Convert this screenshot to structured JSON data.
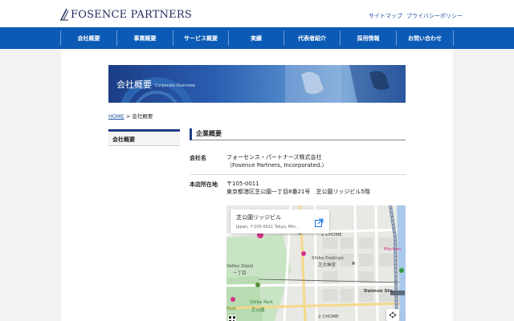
{
  "header": {
    "logo_text": "FOSENCE PARTNERS",
    "sitemap": "サイトマップ",
    "privacy": "プライバシーポリシー"
  },
  "nav": {
    "items": [
      "会社概要",
      "事業概要",
      "サービス概要",
      "実績",
      "代表者紹介",
      "採用情報",
      "お問い合わせ"
    ]
  },
  "banner": {
    "title": "会社概要",
    "subtitle": "Corporate Overview"
  },
  "breadcrumb": {
    "home": "HOME",
    "separator": ">",
    "current": "会社概要"
  },
  "sidebar": {
    "items": [
      "会社概要"
    ]
  },
  "section": {
    "title": "企業概要"
  },
  "company": {
    "name_label": "会社名",
    "name_ja": "フォーセンス・パートナーズ株式会社",
    "name_en": "（Fosence Partners, Incorporated.）",
    "address_label": "本店所在地",
    "postal": "〒105-0011",
    "address": "東京都港区芝公園一丁目8番21号　芝公園リッジビル5階"
  },
  "map": {
    "place_title": "芝公園リッジビル",
    "place_address": "Japan, 〒105-0011 Tokyo, Min...",
    "labels": {
      "chome1": "1 CHOME",
      "chome2": "2 CHOME",
      "valley": "Valley Zojoji",
      "valley_sub": "ー丁目",
      "shiba_daijingu": "Shiba Daijingū",
      "shiba_daijingu_sub": "芝大神宮",
      "daimon": "Daimon Sta",
      "shiba_park": "Shiba Park",
      "shiba_park_sub": "芝公園",
      "park": "Park",
      "machan": "Machan"
    }
  },
  "colors": {
    "nav_bg": "#0b5bb6",
    "banner_dark": "#1c3d86",
    "link": "#1d4fa1",
    "map_pin": "#d6338a"
  }
}
